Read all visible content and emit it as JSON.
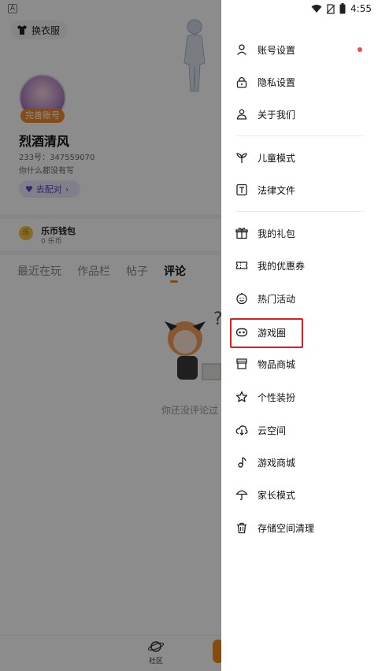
{
  "status_bar": {
    "time": "4:55",
    "left_badge": "A"
  },
  "profile": {
    "dress_button_label": "换衣服",
    "complete_badge": "完善账号",
    "nickname": "烈酒清风",
    "uid": "233号：347559070",
    "bio": "你什么都没有写",
    "pair_button": "去配对",
    "wallet_title": "乐币钱包",
    "wallet_value": "0 乐币",
    "wallet_icon_text": "乐",
    "tabs": [
      "最近在玩",
      "作品栏",
      "帖子",
      "评论"
    ],
    "active_tab": "评论",
    "empty_text": "你还没评论过",
    "bottom_nav": {
      "community_label": "社区"
    }
  },
  "drawer": {
    "groups": [
      [
        {
          "label": "账号设置",
          "icon": "person-icon",
          "badge_dot": true
        },
        {
          "label": "隐私设置",
          "icon": "lock-icon"
        },
        {
          "label": "关于我们",
          "icon": "contact-icon"
        }
      ],
      [
        {
          "label": "儿童模式",
          "icon": "sprout-icon"
        },
        {
          "label": "法律文件",
          "icon": "document-t-icon"
        }
      ],
      [
        {
          "label": "我的礼包",
          "icon": "gift-icon"
        },
        {
          "label": "我的优惠券",
          "icon": "coupon-icon"
        },
        {
          "label": "热门活动",
          "icon": "smiley-icon"
        },
        {
          "label": "游戏圈",
          "icon": "gamepad-icon",
          "highlighted": true
        },
        {
          "label": "物品商城",
          "icon": "shop-icon"
        },
        {
          "label": "个性装扮",
          "icon": "star-icon"
        },
        {
          "label": "云空间",
          "icon": "cloud-download-icon"
        },
        {
          "label": "游戏商城",
          "icon": "music-note-icon"
        },
        {
          "label": "家长模式",
          "icon": "umbrella-icon"
        },
        {
          "label": "存储空间清理",
          "icon": "trash-icon"
        }
      ]
    ],
    "highlight_color": "#e01b1b",
    "badge_dot_color": "#ee4d4d"
  },
  "colors": {
    "accent_orange": "#f28a1c",
    "pair_purple": "#5a45c4"
  }
}
